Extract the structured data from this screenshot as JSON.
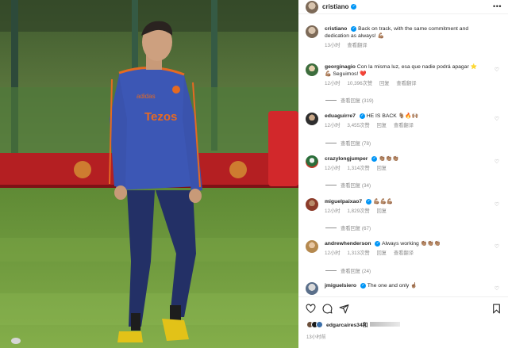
{
  "post": {
    "author": "cristiano",
    "more_icon": "more-horizontal-icon"
  },
  "photo": {
    "jersey_sponsor": "Tezos",
    "jersey_text": "Tezos",
    "crest_colors": {
      "kit": "#3b56b8",
      "accent": "#e05a1a",
      "grass": "#6f9b3c"
    }
  },
  "caption": {
    "username": "cristiano",
    "text": "Back on track, with the same commitment and dedication as always! 💪🏽",
    "time": "13小时",
    "translate": "查看翻译"
  },
  "comments": [
    {
      "username": "georginagio",
      "text": "Con la misma luz, esa que nadie podrá apagar ⭐💪🏽 Seguimos! ❤️",
      "time": "12小时",
      "likes": "10,396次赞",
      "reply": "回复",
      "translate": "查看翻译",
      "replies": "查看回复 (319)"
    },
    {
      "username": "eduaguirre7",
      "text": "HE IS BACK 🐐🔥🙌🏽",
      "time": "12小时",
      "likes": "3,455次赞",
      "reply": "回复",
      "translate": "查看翻译",
      "replies": "查看回复 (78)"
    },
    {
      "username": "crazylongjumper",
      "text": "👏🏽👏🏽👏🏽",
      "time": "12小时",
      "likes": "1,314次赞",
      "reply": "回复",
      "translate": "",
      "replies": "查看回复 (34)"
    },
    {
      "username": "miguelpaixao7",
      "text": "💪🏽💪🏽💪🏽",
      "time": "12小时",
      "likes": "1,829次赞",
      "reply": "回复",
      "translate": "",
      "replies": "查看回复 (67)"
    },
    {
      "username": "andrewhenderson",
      "text": "Always working 👏🏽👏🏽👏🏽",
      "time": "12小时",
      "likes": "1,313次赞",
      "reply": "回复",
      "translate": "查看翻译",
      "replies": "查看回复 (24)"
    },
    {
      "username": "jmiguelsiero",
      "text": "The one and only ☝🏽",
      "time": "",
      "likes": "",
      "reply": "",
      "translate": "",
      "replies": ""
    }
  ],
  "actions": {
    "like_icon": "heart-icon",
    "comment_icon": "comment-icon",
    "share_icon": "share-icon",
    "save_icon": "bookmark-icon"
  },
  "likes_line": {
    "user": "edgarcaires34和"
  },
  "timestamp": "13小时前"
}
